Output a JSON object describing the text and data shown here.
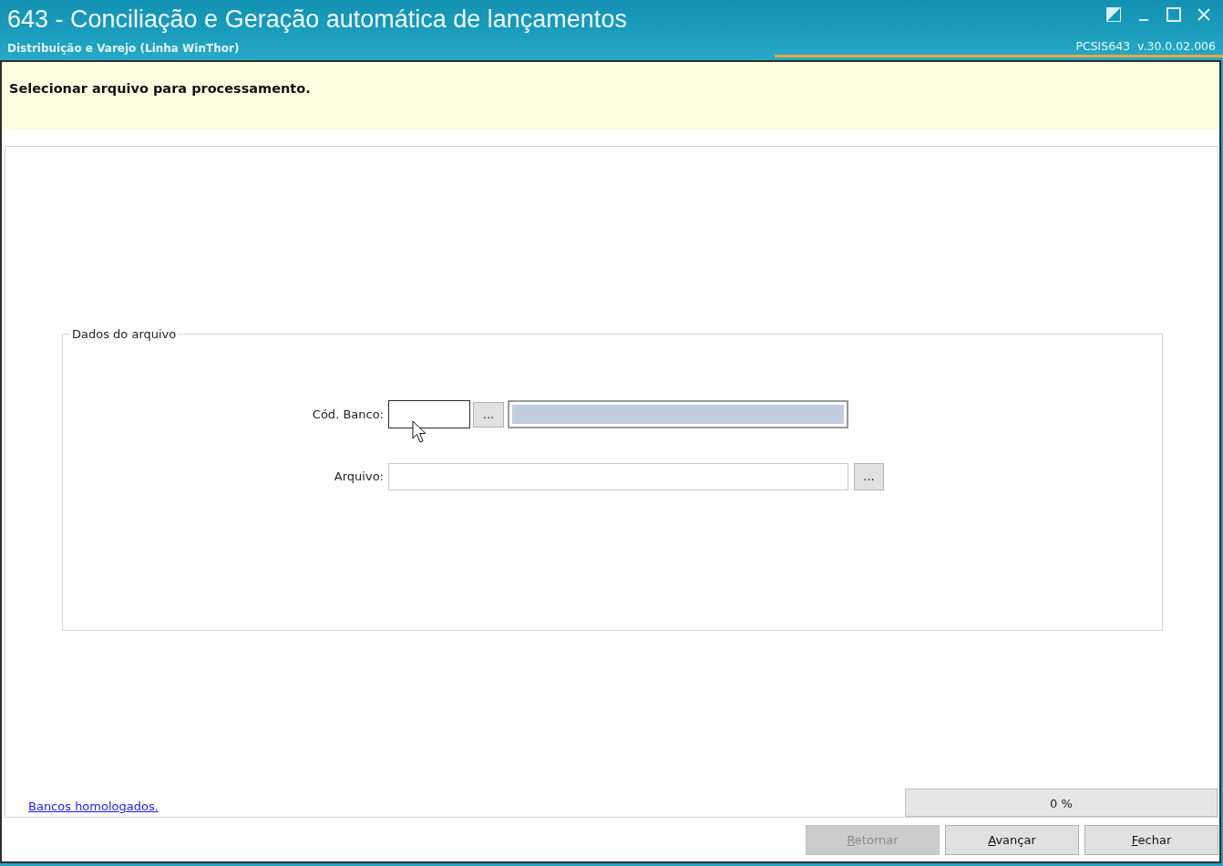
{
  "window": {
    "title": "643 - Conciliação e Geração automática de lançamentos",
    "subtitle": "Distribuição e Varejo (Linha WinThor)",
    "version": "PCSIS643  v.30.0.02.006"
  },
  "header": {
    "text": "Selecionar arquivo para processamento."
  },
  "group": {
    "title": "Dados do arquivo",
    "fields": [
      {
        "kind": "lookup",
        "label": "Cód. Banco:",
        "focused": true,
        "browse_button": "..."
      },
      {
        "kind": "file",
        "label": "Arquivo:",
        "focused": false,
        "browse_button": "..."
      }
    ]
  },
  "link": "Bancos homologados.",
  "progress": {
    "level": 0,
    "reading": "0 %"
  },
  "buttons": [
    {
      "label": "Retornar",
      "disabled": true
    },
    {
      "label": "Avançar",
      "disabled": false
    },
    {
      "label": "Fechar",
      "disabled": false
    }
  ]
}
